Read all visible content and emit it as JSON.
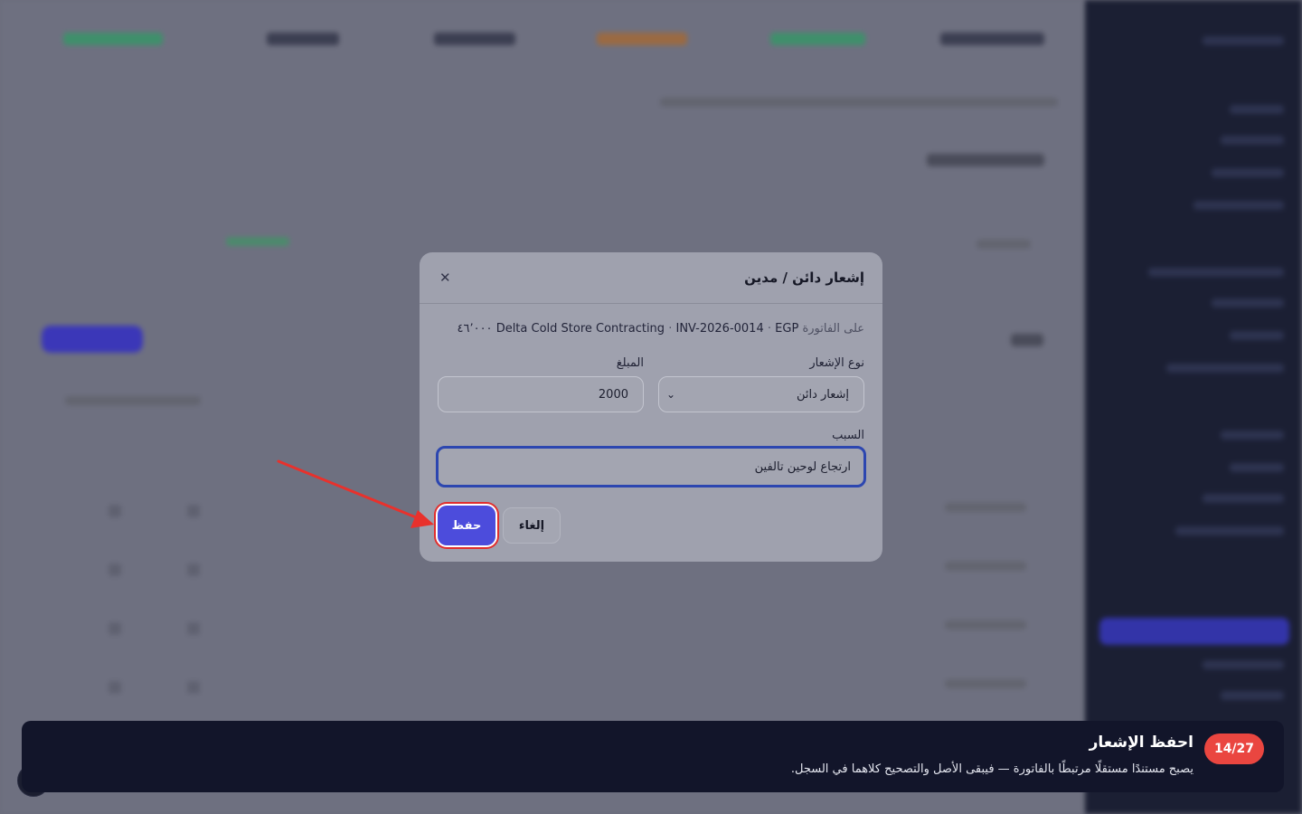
{
  "dialog": {
    "title": "إشعار دائن / مدين",
    "close_icon": "close-icon",
    "invoice_prefix": "على الفاتورة",
    "customer": "Delta Cold Store Contracting",
    "invoice_number": "INV-2026-0014",
    "amount_total": "EGP ٤٦٬٠٠٠",
    "type_label": "نوع الإشعار",
    "type_value": "إشعار دائن",
    "amount_label": "المبلغ",
    "amount_value": "2000",
    "reason_label": "السبب",
    "reason_value": "ارتجاع لوحين تالفين",
    "save_label": "حفظ",
    "cancel_label": "إلغاء"
  },
  "toast": {
    "step": "14/27",
    "title": "احفظ الإشعار",
    "description": "يصبح مستندًا مستقلًا مرتبطًا بالفاتورة — فيبقى الأصل والتصحيح كلاهما في السجل."
  },
  "colors": {
    "primary": "#4c4cdc",
    "highlight": "#e02e2e",
    "badge": "#ea4640",
    "toast_bg": "#12152a",
    "sidebar_bg": "#1b1f33"
  }
}
